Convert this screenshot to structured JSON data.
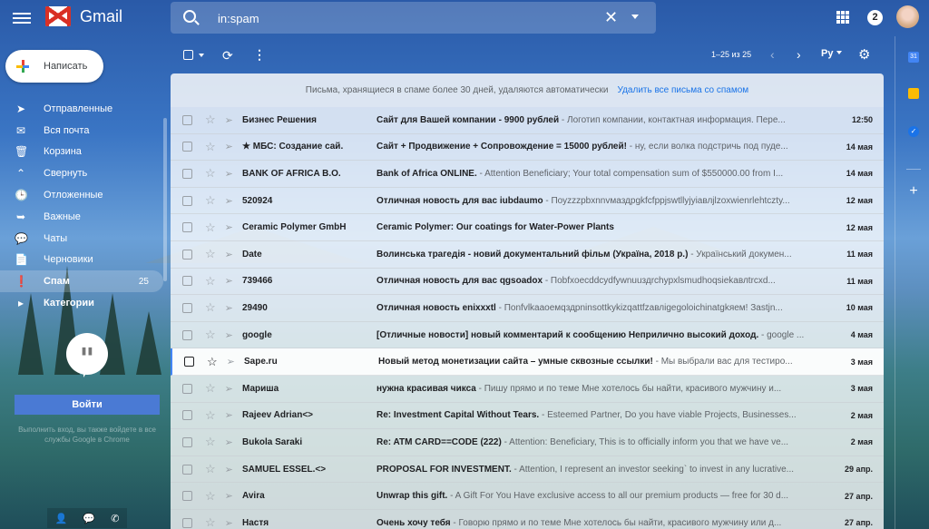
{
  "app": {
    "logo_text": "Gmail"
  },
  "search": {
    "value": "in:spam"
  },
  "header": {
    "notification_count": "2"
  },
  "compose": {
    "label": "Написать"
  },
  "nav": {
    "items": [
      {
        "icon": "send-icon",
        "glyph": "➤",
        "label": "Отправленные",
        "count": ""
      },
      {
        "icon": "mail-icon",
        "glyph": "✉",
        "label": "Вся почта",
        "count": ""
      },
      {
        "icon": "trash-icon",
        "glyph": "🗑",
        "label": "Корзина",
        "count": ""
      },
      {
        "icon": "chevron-up-icon",
        "glyph": "⌃",
        "label": "Свернуть",
        "count": ""
      },
      {
        "icon": "clock-icon",
        "glyph": "🕒",
        "label": "Отложенные",
        "count": ""
      },
      {
        "icon": "important-icon",
        "glyph": "➥",
        "label": "Важные",
        "count": ""
      },
      {
        "icon": "chat-icon",
        "glyph": "💬",
        "label": "Чаты",
        "count": ""
      },
      {
        "icon": "draft-icon",
        "glyph": "📄",
        "label": "Черновики",
        "count": ""
      },
      {
        "icon": "spam-icon",
        "glyph": "❗",
        "label": "Спам",
        "count": "25"
      },
      {
        "icon": "label-icon",
        "glyph": "▸",
        "label": "Категории",
        "count": ""
      }
    ]
  },
  "hangouts": {
    "signin_label": "Войти",
    "note": "Выполнить вход, вы также войдете в все службы Google в Chrome"
  },
  "toolbar": {
    "pager": "1–25 из 25",
    "language": "Ру"
  },
  "banner": {
    "text": "Письма, хранящиеся в спаме более 30 дней, удаляются автоматически",
    "action": "Удалить все письма со спамом"
  },
  "emails": [
    {
      "sender": "Бизнес Решения",
      "subject": "Сайт для Вашей компании - 9900 рублей",
      "snippet": " - Логотип компании, контактная информация. Пере...",
      "date": "12:50"
    },
    {
      "sender": "★ МБС: Создание сай.",
      "subject": "Сайт + Продвижение + Сопровождение = 15000 рублей!",
      "snippet": " - ну, если волка подстричь под пуде...",
      "date": "14 мая"
    },
    {
      "sender": "BANK OF AFRICA B.O.",
      "subject": "Bank of Africa ONLINE.",
      "snippet": " - Attention Beneficiary; Your total compensation sum of $550000.00 from I...",
      "date": "14 мая"
    },
    {
      "sender": "520924",
      "subject": "Отличная новость для вас iubdaumo",
      "snippet": " - Поуzzzpbxnnvмаздрgkfcfppjswtllyjyiавлjlzoxwienrlehtczty...",
      "date": "12 мая"
    },
    {
      "sender": "Ceramic Polymer GmbH",
      "subject": "Ceramic Polymer: Our coatings for Water-Power Plants",
      "snippet": "",
      "date": "12 мая"
    },
    {
      "sender": "Date",
      "subject": "Волинська трагедія - новий документальний фільм (Україна, 2018 р.)",
      "snippet": " - Український докумен...",
      "date": "11 мая"
    },
    {
      "sender": "739466",
      "subject": "Отличная новость для вас qgsoadox",
      "snippet": " - Пobfxoecddcydfywnuuздrchypxlsmudhoqsiekавлtrcxd...",
      "date": "11 мая"
    },
    {
      "sender": "29490",
      "subject": "Отличная новость enixxxtl",
      "snippet": " - Пonfvlkaaoeмqздpninsottkykizqattfzавлigegoloichinatgkяем! Зastjn...",
      "date": "10 мая"
    },
    {
      "sender": "google",
      "subject": "[Отличные новости] новый комментарий к сообщению Неприлично высокий доход.",
      "snippet": " - google ...",
      "date": "4 мая"
    },
    {
      "sender": "Sape.ru",
      "subject": "Новый метод монетизации сайта – умные сквозные ссылки!",
      "snippet": " - Мы выбрали вас для тестиро...",
      "date": "3 мая"
    },
    {
      "sender": "Мариша",
      "subject": "нужна красивая чикса",
      "snippet": " - Пишу прямо и по теме Мне хотелось бы найти, красивого мужчину и...",
      "date": "3 мая"
    },
    {
      "sender": "Rajeev Adrian<>",
      "subject": "Re: Investment Capital Without Tears.",
      "snippet": " - Esteemed Partner, Do you have viable Projects, Businesses...",
      "date": "2 мая"
    },
    {
      "sender": "Bukola Saraki",
      "subject": "Re: ATM CARD==CODE (222)",
      "snippet": " - Attention: Beneficiary, This is to officially inform you that we have ve...",
      "date": "2 мая"
    },
    {
      "sender": "SAMUEL ESSEL.<>",
      "subject": "PROPOSAL FOR INVESTMENT.",
      "snippet": " - Attention, I represent an investor seeking` to invest in any lucrative...",
      "date": "29 апр."
    },
    {
      "sender": "Avira",
      "subject": "Unwrap this gift.",
      "snippet": " - A Gift For You Have exclusive access to all our premium products — free for 30 d...",
      "date": "27 апр."
    },
    {
      "sender": "Настя",
      "subject": "Очень хочу тебя",
      "snippet": " - Говорю прямо и по теме Мне хотелось бы найти, красивого мужчину или д...",
      "date": "27 апр."
    }
  ],
  "sidepanel": {
    "calendar_day": "31"
  }
}
